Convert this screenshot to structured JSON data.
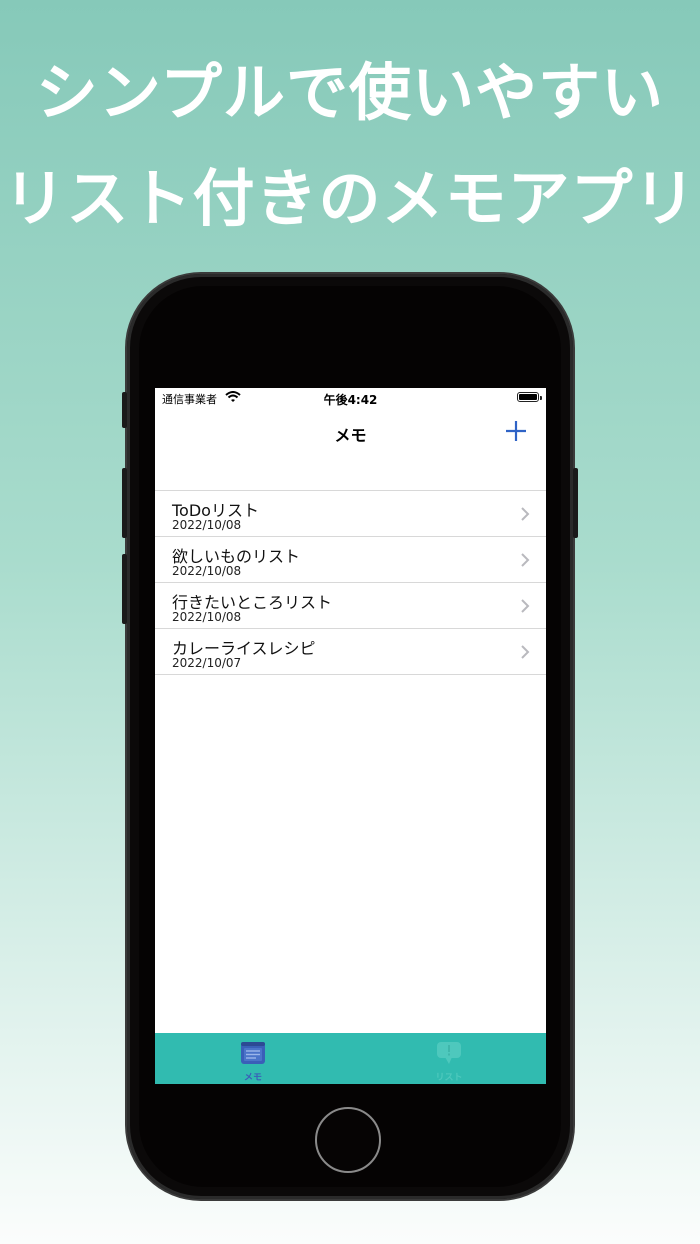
{
  "promo": {
    "line1": "シンプルで使いやすい",
    "line2": "リスト付きのメモアプリ"
  },
  "statusbar": {
    "carrier": "通信事業者",
    "time": "午後4:42"
  },
  "navbar": {
    "title": "メモ",
    "add_icon": "plus-icon"
  },
  "memos": [
    {
      "title": "ToDoリスト",
      "date": "2022/10/08"
    },
    {
      "title": "欲しいものリスト",
      "date": "2022/10/08"
    },
    {
      "title": "行きたいところリスト",
      "date": "2022/10/08"
    },
    {
      "title": "カレーライスレシピ",
      "date": "2022/10/07"
    }
  ],
  "tabbar": {
    "tabs": [
      {
        "label": "メモ",
        "icon": "note-icon",
        "selected": true
      },
      {
        "label": "リスト",
        "icon": "speech-bubble-icon",
        "selected": false
      }
    ]
  },
  "colors": {
    "accent": "#2f63c6",
    "tabbar_bg": "#31bbb0",
    "background_top": "#86c9b9"
  }
}
